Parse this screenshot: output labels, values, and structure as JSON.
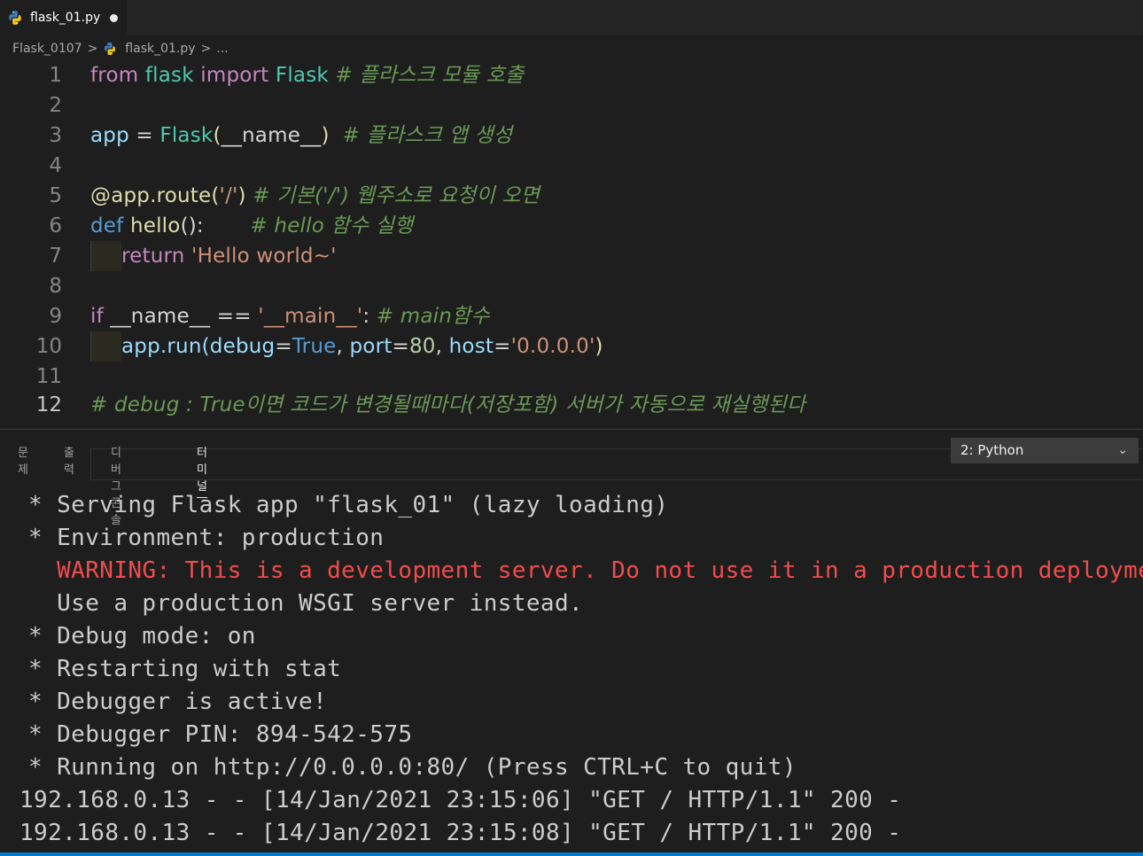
{
  "tab": {
    "filename": "flask_01.py",
    "icon": "python-icon"
  },
  "breadcrumb": {
    "folder": "Flask_0107",
    "file": "flask_01.py",
    "more": "..."
  },
  "editor": {
    "line_numbers": [
      "1",
      "2",
      "3",
      "4",
      "5",
      "6",
      "7",
      "8",
      "9",
      "10",
      "11",
      "12"
    ],
    "active_line": 12,
    "lines": {
      "l1": {
        "from": "from",
        "module": "flask",
        "import": "import",
        "cls": "Flask",
        "comment": "# 플라스크 모듈 호출"
      },
      "l3": {
        "var": "app",
        "eq": " = ",
        "cls": "Flask",
        "open": "(",
        "arg": "__name__",
        "close": ")",
        "comment": "# 플라스크 앱 생성"
      },
      "l5": {
        "deco": "@app.route(",
        "str": "'/'",
        "close": ")",
        "comment": "# 기본('/') 웹주소로 요청이 오면"
      },
      "l6": {
        "def": "def",
        "fn": "hello",
        "rest": "():",
        "comment": "# hello 함수 실행"
      },
      "l7": {
        "ret": "return",
        "str": "'Hello world~'"
      },
      "l9": {
        "if": "if",
        "name": "__name__",
        "eq": " == ",
        "str": "'__main__'",
        "colon": ":",
        "comment": "# main함수"
      },
      "l10": {
        "call": "app.run(",
        "debug": "debug",
        "eq1": "=",
        "true": "True",
        "comma1": ", ",
        "port": "port",
        "eq2": "=",
        "num": "80",
        "comma2": ", ",
        "host": "host",
        "eq3": "=",
        "str": "'0.0.0.0'",
        "close": ")"
      },
      "l12": {
        "comment": "# debug : True이면 코드가 변경될때마다(저장포함) 서버가 자동으로 재실행된다"
      }
    }
  },
  "panel": {
    "tabs": [
      "문제",
      "출력",
      "디버그 콘솔",
      "터미널"
    ],
    "active_tab": "터미널",
    "terminal_select": "2: Python"
  },
  "terminal": {
    "lines": [
      "* Serving Flask app \"flask_01\" (lazy loading)",
      "* Environment: production",
      "  WARNING: This is a development server. Do not use it in a production deployment.",
      "  Use a production WSGI server instead.",
      "* Debug mode: on",
      "* Restarting with stat",
      "* Debugger is active!",
      "* Debugger PIN: 894-542-575",
      "* Running on http://0.0.0.0:80/ (Press CTRL+C to quit)",
      "192.168.0.13 - - [14/Jan/2021 23:15:06] \"GET / HTTP/1.1\" 200 -",
      "192.168.0.13 - - [14/Jan/2021 23:15:08] \"GET / HTTP/1.1\" 200 -"
    ]
  },
  "colors": {
    "accent": "#007acc",
    "warning": "#f14c4c",
    "comment": "#6a9955"
  }
}
